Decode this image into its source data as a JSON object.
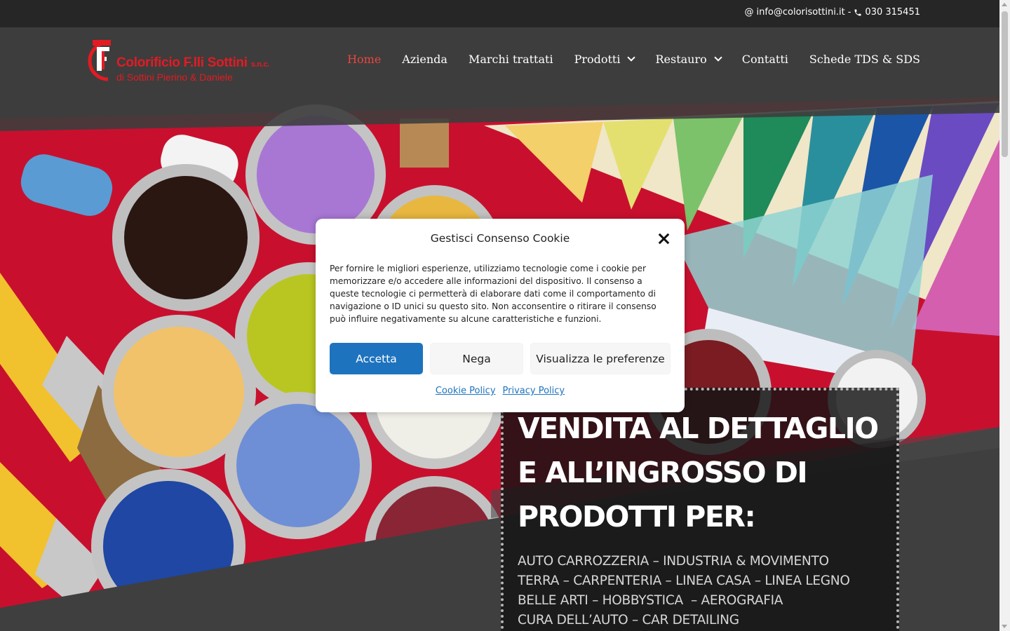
{
  "topbar": {
    "email": "info@colorisottini.it",
    "separator": "-",
    "phone": "030 315451"
  },
  "logo": {
    "name": "Colorificio F.lli Sottini",
    "suffix": "s.n.c.",
    "owners": "di Sottini Pierino & Daniele"
  },
  "nav": {
    "items": [
      {
        "label": "Home"
      },
      {
        "label": "Azienda"
      },
      {
        "label": "Marchi trattati"
      },
      {
        "label": "Prodotti"
      },
      {
        "label": "Restauro"
      },
      {
        "label": "Contatti"
      },
      {
        "label": "Schede TDS & SDS"
      }
    ]
  },
  "hero": {
    "headline_1": "VENDITA AL DETTAGLIO",
    "headline_2": "E ALL’INGROSSO DI",
    "headline_3": "PRODOTTI PER:",
    "sub_1": "AUTO CARROZZERIA – INDUSTRIA & MOVIMENTO",
    "sub_2": "TERRA – CARPENTERIA – LINEA CASA – LINEA LEGNO",
    "sub_3": "BELLE ARTI – HOBBYSTICA  – AEROGRAFIA",
    "sub_4": "CURA DELL’AUTO – CAR DETAILING"
  },
  "cookie_modal": {
    "title": "Gestisci Consenso Cookie",
    "text": "Per fornire le migliori esperienze, utilizziamo tecnologie come i cookie per memorizzare e/o accedere alle informazioni del dispositivo. Il consenso a queste tecnologie ci permetterà di elaborare dati come il comportamento di navigazione o ID unici su questo sito. Non acconsentire o ritirare il consenso può influire negativamente su alcune caratteristiche e funzioni.",
    "accept_label": "Accetta",
    "deny_label": "Nega",
    "prefs_label": "Visualizza le preferenze",
    "cookie_policy_label": "Cookie Policy",
    "privacy_policy_label": "Privacy Policy"
  },
  "colors": {
    "accent": "#e8463e",
    "brand_red": "#e31b23",
    "button_blue": "#1e73be",
    "topbar": "#262626",
    "header": "#3d3d3d"
  },
  "icons": {
    "email": "at-icon",
    "phone": "phone-icon",
    "close": "close-icon",
    "dropdown": "chevron-down-icon"
  }
}
